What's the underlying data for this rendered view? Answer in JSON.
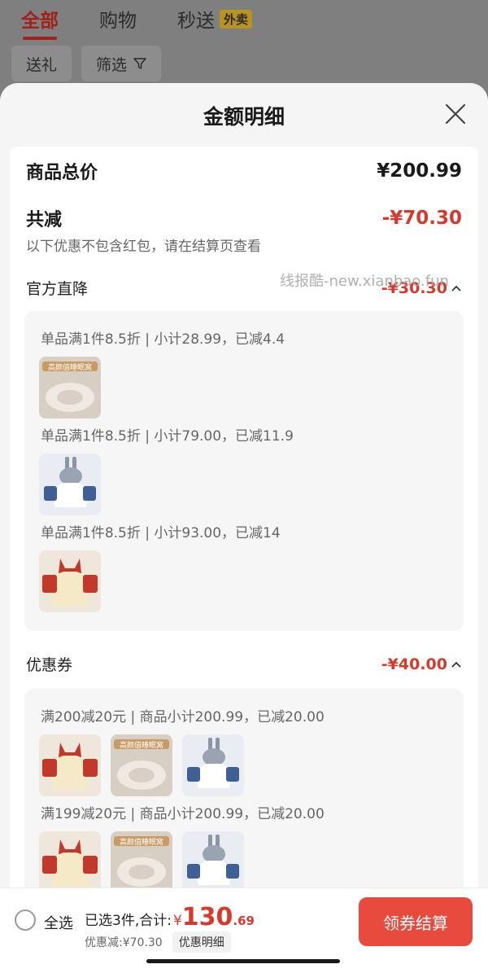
{
  "background": {
    "tabs": [
      {
        "label": "全部",
        "active": true
      },
      {
        "label": "购物",
        "active": false
      },
      {
        "label": "秒送",
        "active": false,
        "badge": "外卖"
      }
    ],
    "chips": [
      {
        "label": "送礼"
      },
      {
        "label": "筛选",
        "icon": "funnel-icon"
      }
    ]
  },
  "sheet": {
    "title": "金额明细",
    "total_label": "商品总价",
    "total_value": "¥200.99",
    "reduce_label": "共减",
    "reduce_value": "-¥70.30",
    "note": "以下优惠不包含红包，请在结算页查看",
    "watermark": "线报酷-new.xianbao.fun",
    "sections": [
      {
        "label": "官方直降",
        "amount": "-¥30.30",
        "groups": [
          {
            "text": "单品满1件8.5折 | 小计28.99，已减4.4",
            "items": [
              "pet-bed"
            ]
          },
          {
            "text": "单品满1件8.5折 | 小计79.00，已减11.9",
            "items": [
              "bunny-hoodie"
            ]
          },
          {
            "text": "单品满1件8.5折 | 小计93.00，已减14",
            "items": [
              "fox-hoodie"
            ]
          }
        ]
      },
      {
        "label": "优惠券",
        "amount": "-¥40.00",
        "groups": [
          {
            "text": "满200减20元 | 商品小计200.99，已减20.00",
            "items": [
              "fox-hoodie",
              "pet-bed",
              "bunny-hoodie"
            ]
          },
          {
            "text": "满199减20元 | 商品小计200.99，已减20.00",
            "items": [
              "fox-hoodie",
              "pet-bed",
              "bunny-hoodie"
            ]
          }
        ]
      }
    ]
  },
  "bottom": {
    "select_all": "全选",
    "selected_text": "已选3件,合计:",
    "currency": "¥",
    "total_int": "130",
    "total_dec": ".69",
    "savings": "优惠减:¥70.30",
    "detail_button": "优惠明细",
    "checkout_button": "领券结算"
  },
  "colors": {
    "accent": "#d53a2c",
    "checkout": "#e94a3e"
  }
}
